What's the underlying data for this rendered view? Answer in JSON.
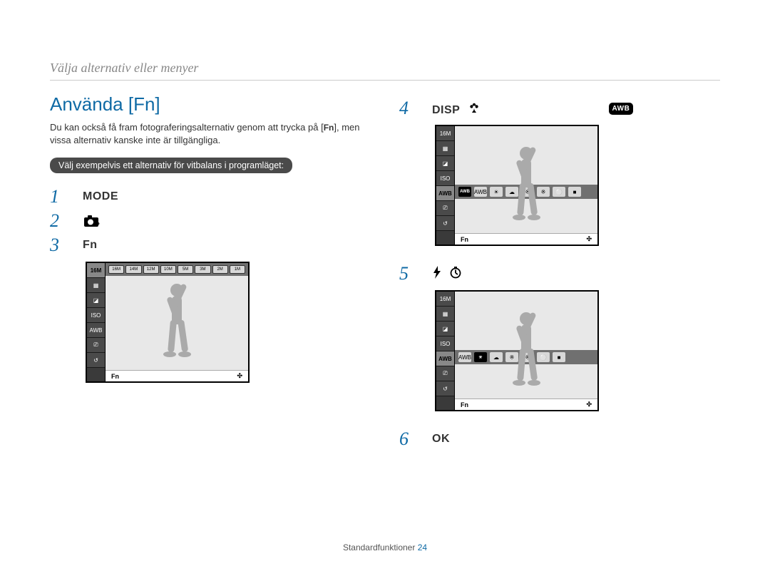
{
  "breadcrumb": "Välja alternativ eller menyer",
  "section_title": "Använda [Fn]",
  "intro_line1": "Du kan också få fram fotograferingsalternativ genom att trycka på",
  "intro_line2": ", men vissa alternativ kanske inte är tillgängliga.",
  "fn_label": "Fn",
  "note_bar": "Välj exempelvis ett alternativ för vitbalans i programläget:",
  "steps": {
    "s1": {
      "num": "1",
      "label": "MODE"
    },
    "s2": {
      "num": "2",
      "mode_icon": "program-mode-icon"
    },
    "s3": {
      "num": "3",
      "label": "Fn"
    },
    "s4": {
      "num": "4",
      "label": "DISP",
      "flower_icon": "flower-icon",
      "awb": "AWB"
    },
    "s5": {
      "num": "5",
      "flash_icon": "flash-icon",
      "timer_icon": "timer-icon"
    },
    "s6": {
      "num": "6",
      "label": "OK"
    }
  },
  "camera_ui": {
    "sidebar_icons": [
      "16M",
      "▦",
      "◪",
      "ISO",
      "AWB",
      "⎚",
      "↺"
    ],
    "top_chips": [
      "16M",
      "14M",
      "12M",
      "10M",
      "5M",
      "3M",
      "2M",
      "1M"
    ],
    "wb_icons_labels": [
      "AWB",
      "AWB",
      "☀",
      "☁",
      "※",
      "※",
      "⚪",
      "■"
    ],
    "bottom_left": "Fn",
    "bottom_right": "✣"
  },
  "footer": {
    "label": "Standardfunktioner",
    "page": "24"
  }
}
